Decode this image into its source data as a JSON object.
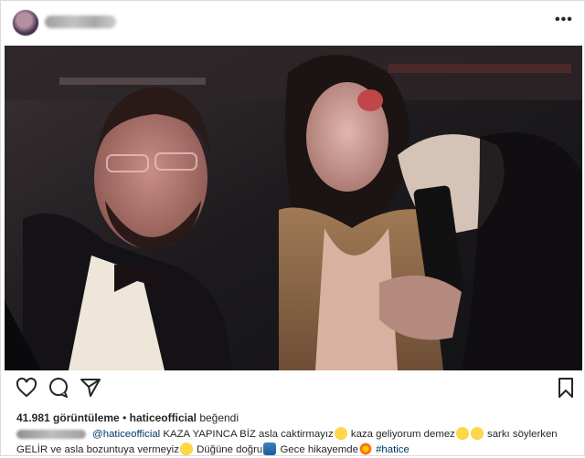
{
  "header": {
    "avatar_icon": "avatar",
    "username_blurred": true,
    "more_icon": "more-horizontal-icon"
  },
  "post": {
    "media_type": "video",
    "views_count": "41.981",
    "views_label": "görüntüleme",
    "liked_by_user": "haticeofficial",
    "liked_by_suffix": "beğendi",
    "caption": {
      "mention": "@haticeofficial",
      "part1": "KAZA YAPINCA BİZ asla caktirmayız",
      "part2": "kaza geliyorum demez",
      "part3": " sarkı söylerken GELİR ve asla bozuntuya vermeyiz",
      "part4": " Düğüne doğru",
      "part5": " Gece hikayemde",
      "hashtag": "#hatice"
    }
  },
  "actions": {
    "like_icon": "heart-icon",
    "comment_icon": "comment-icon",
    "share_icon": "share-icon",
    "save_icon": "bookmark-icon"
  },
  "colors": {
    "link": "#003569",
    "text": "#262626",
    "border": "#dbdbdb"
  }
}
